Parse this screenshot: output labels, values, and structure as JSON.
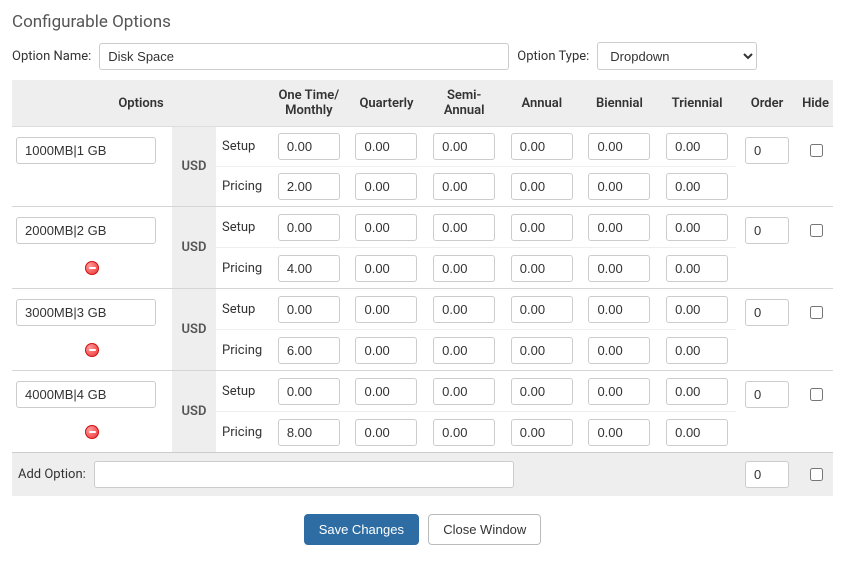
{
  "title": "Configurable Options",
  "labels": {
    "option_name": "Option Name:",
    "option_type": "Option Type:",
    "options_col": "Options",
    "setup": "Setup",
    "pricing": "Pricing",
    "add_option": "Add Option:",
    "order": "Order",
    "hide": "Hide"
  },
  "option_name_value": "Disk Space",
  "option_type_value": "Dropdown",
  "columns": {
    "c0": "One Time/\nMonthly",
    "c1": "Quarterly",
    "c2": "Semi-\nAnnual",
    "c3": "Annual",
    "c4": "Biennial",
    "c5": "Triennial"
  },
  "currency": "USD",
  "rows": [
    {
      "name": "1000MB|1 GB",
      "setup": [
        "0.00",
        "0.00",
        "0.00",
        "0.00",
        "0.00",
        "0.00"
      ],
      "pricing": [
        "2.00",
        "0.00",
        "0.00",
        "0.00",
        "0.00",
        "0.00"
      ],
      "order": "0",
      "removable": false
    },
    {
      "name": "2000MB|2 GB",
      "setup": [
        "0.00",
        "0.00",
        "0.00",
        "0.00",
        "0.00",
        "0.00"
      ],
      "pricing": [
        "4.00",
        "0.00",
        "0.00",
        "0.00",
        "0.00",
        "0.00"
      ],
      "order": "0",
      "removable": true
    },
    {
      "name": "3000MB|3 GB",
      "setup": [
        "0.00",
        "0.00",
        "0.00",
        "0.00",
        "0.00",
        "0.00"
      ],
      "pricing": [
        "6.00",
        "0.00",
        "0.00",
        "0.00",
        "0.00",
        "0.00"
      ],
      "order": "0",
      "removable": true
    },
    {
      "name": "4000MB|4 GB",
      "setup": [
        "0.00",
        "0.00",
        "0.00",
        "0.00",
        "0.00",
        "0.00"
      ],
      "pricing": [
        "8.00",
        "0.00",
        "0.00",
        "0.00",
        "0.00",
        "0.00"
      ],
      "order": "0",
      "removable": true
    }
  ],
  "add_option_value": "",
  "add_order_value": "0",
  "buttons": {
    "save": "Save Changes",
    "close": "Close Window"
  }
}
